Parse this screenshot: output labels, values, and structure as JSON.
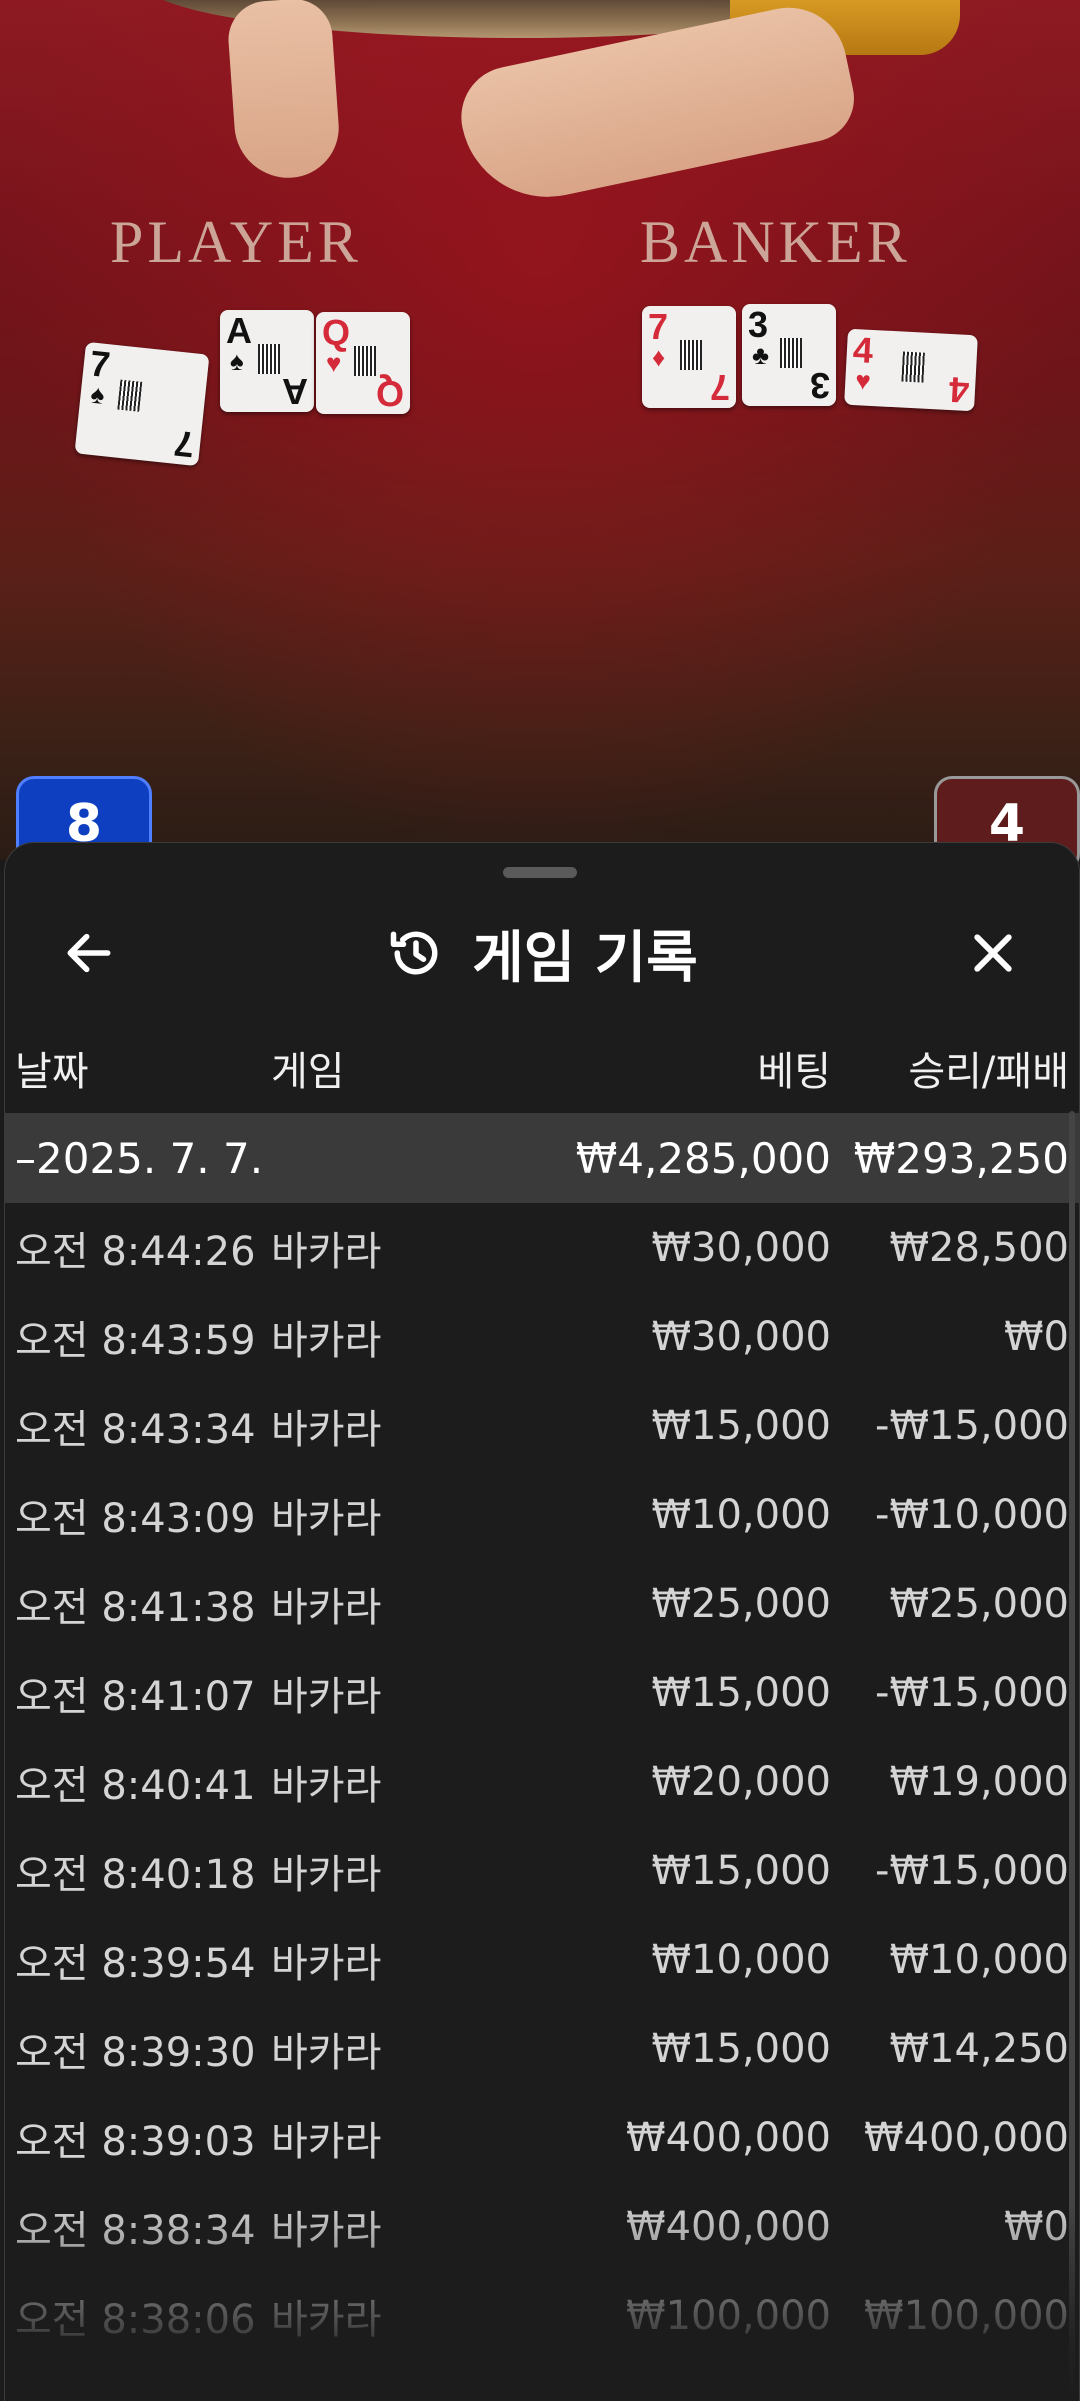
{
  "stream": {
    "player_label": "PLAYER",
    "banker_label": "BANKER",
    "player_cards": [
      {
        "rank": "7",
        "suit": "♠",
        "color": "black"
      },
      {
        "rank": "A",
        "suit": "♠",
        "color": "black"
      },
      {
        "rank": "Q",
        "suit": "♥",
        "color": "red"
      }
    ],
    "banker_cards": [
      {
        "rank": "7",
        "suit": "♦",
        "color": "red"
      },
      {
        "rank": "3",
        "suit": "♣",
        "color": "black"
      },
      {
        "rank": "4",
        "suit": "♥",
        "color": "red"
      }
    ],
    "player_score": "8",
    "banker_score": "4"
  },
  "sheet": {
    "title": "게임 기록",
    "back_icon": "arrow-left-icon",
    "history_icon": "history-icon",
    "close_icon": "close-icon"
  },
  "table": {
    "headers": {
      "date": "날짜",
      "game": "게임",
      "bet": "베팅",
      "result": "승리/패배"
    },
    "summary": {
      "date": "–2025. 7. 7.",
      "bet": "₩4,285,000",
      "result": "₩293,250"
    },
    "rows": [
      {
        "time": "오전 8:44:26",
        "game": "바카라",
        "bet": "₩30,000",
        "result": "₩28,500"
      },
      {
        "time": "오전 8:43:59",
        "game": "바카라",
        "bet": "₩30,000",
        "result": "₩0"
      },
      {
        "time": "오전 8:43:34",
        "game": "바카라",
        "bet": "₩15,000",
        "result": "-₩15,000"
      },
      {
        "time": "오전 8:43:09",
        "game": "바카라",
        "bet": "₩10,000",
        "result": "-₩10,000"
      },
      {
        "time": "오전 8:41:38",
        "game": "바카라",
        "bet": "₩25,000",
        "result": "₩25,000"
      },
      {
        "time": "오전 8:41:07",
        "game": "바카라",
        "bet": "₩15,000",
        "result": "-₩15,000"
      },
      {
        "time": "오전 8:40:41",
        "game": "바카라",
        "bet": "₩20,000",
        "result": "₩19,000"
      },
      {
        "time": "오전 8:40:18",
        "game": "바카라",
        "bet": "₩15,000",
        "result": "-₩15,000"
      },
      {
        "time": "오전 8:39:54",
        "game": "바카라",
        "bet": "₩10,000",
        "result": "₩10,000"
      },
      {
        "time": "오전 8:39:30",
        "game": "바카라",
        "bet": "₩15,000",
        "result": "₩14,250"
      },
      {
        "time": "오전 8:39:03",
        "game": "바카라",
        "bet": "₩400,000",
        "result": "₩400,000"
      },
      {
        "time": "오전 8:38:34",
        "game": "바카라",
        "bet": "₩400,000",
        "result": "₩0"
      },
      {
        "time": "오전 8:38:06",
        "game": "바카라",
        "bet": "₩100,000",
        "result": "₩100,000"
      }
    ]
  }
}
